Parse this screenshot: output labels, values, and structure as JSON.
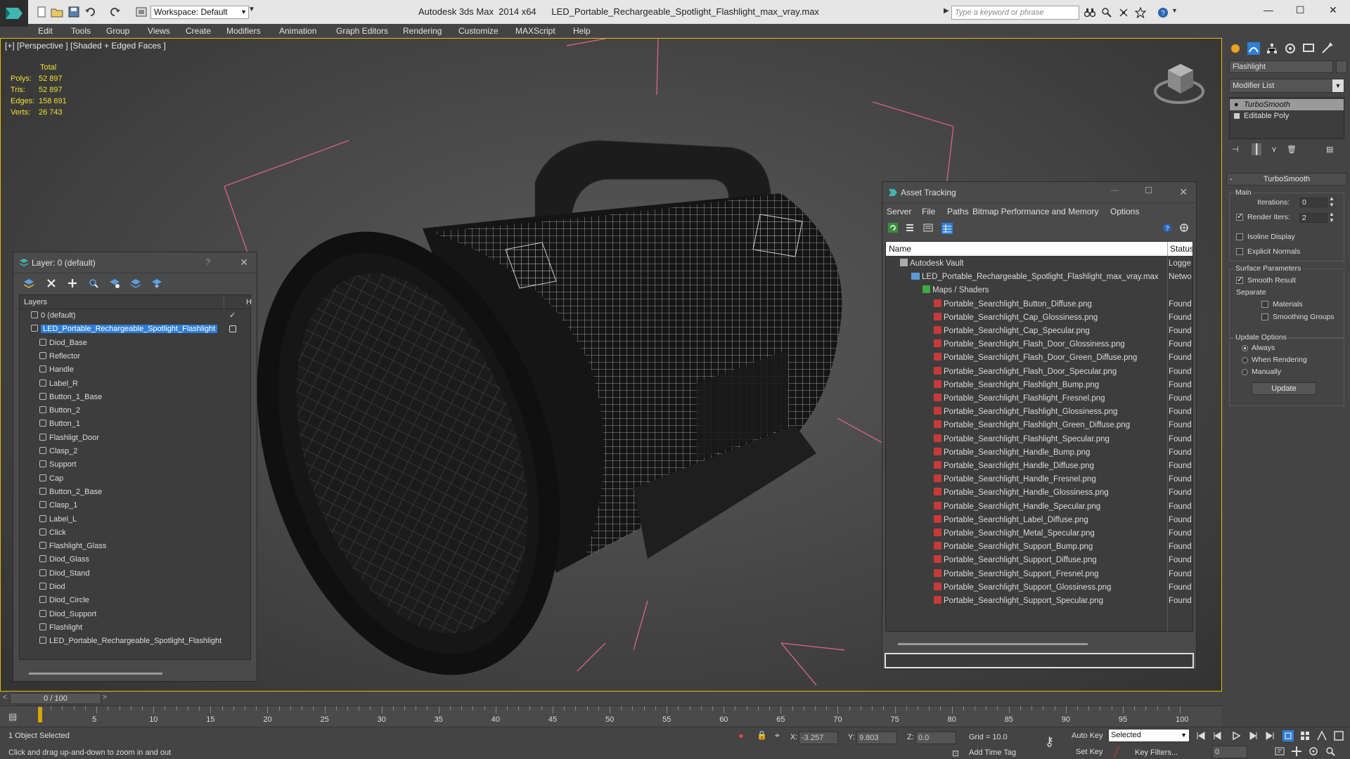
{
  "titlebar": {
    "workspace": "Workspace: Default",
    "title": "Autodesk 3ds Max  2014 x64      LED_Portable_Rechargeable_Spotlight_Flashlight_max_vray.max",
    "search_placeholder": "Type a keyword or phrase"
  },
  "menu": [
    "Edit",
    "Tools",
    "Group",
    "Views",
    "Create",
    "Modifiers",
    "Animation",
    "Graph Editors",
    "Rendering",
    "Customize",
    "MAXScript",
    "Help"
  ],
  "viewport": {
    "label": "[+] [Perspective ] [Shaded + Edged Faces ]",
    "stats_header": "Total",
    "stats": [
      {
        "k": "Polys:",
        "v": "52 897"
      },
      {
        "k": "Tris:",
        "v": "52 897"
      },
      {
        "k": "Edges:",
        "v": "158 691"
      },
      {
        "k": "Verts:",
        "v": "26 743"
      }
    ]
  },
  "layer_panel": {
    "title": "Layer: 0 (default)",
    "help": "?",
    "col_layers": "Layers",
    "col_h": "H",
    "rows": [
      {
        "label": "0 (default)",
        "indent": 0,
        "type": "layer",
        "check": true
      },
      {
        "label": "LED_Portable_Rechargeable_Spotlight_Flashlight",
        "indent": 0,
        "type": "layer",
        "selected": true
      },
      {
        "label": "Diod_Base",
        "indent": 1,
        "type": "obj"
      },
      {
        "label": "Reflector",
        "indent": 1,
        "type": "obj"
      },
      {
        "label": "Handle",
        "indent": 1,
        "type": "obj"
      },
      {
        "label": "Label_R",
        "indent": 1,
        "type": "obj"
      },
      {
        "label": "Button_1_Base",
        "indent": 1,
        "type": "obj"
      },
      {
        "label": "Button_2",
        "indent": 1,
        "type": "obj"
      },
      {
        "label": "Button_1",
        "indent": 1,
        "type": "obj"
      },
      {
        "label": "Flashligt_Door",
        "indent": 1,
        "type": "obj"
      },
      {
        "label": "Clasp_2",
        "indent": 1,
        "type": "obj"
      },
      {
        "label": "Support",
        "indent": 1,
        "type": "obj"
      },
      {
        "label": "Cap",
        "indent": 1,
        "type": "obj"
      },
      {
        "label": "Button_2_Base",
        "indent": 1,
        "type": "obj"
      },
      {
        "label": "Clasp_1",
        "indent": 1,
        "type": "obj"
      },
      {
        "label": "Label_L",
        "indent": 1,
        "type": "obj"
      },
      {
        "label": "Click",
        "indent": 1,
        "type": "obj"
      },
      {
        "label": "Flashlight_Glass",
        "indent": 1,
        "type": "obj"
      },
      {
        "label": "Diod_Glass",
        "indent": 1,
        "type": "obj"
      },
      {
        "label": "Diod_Stand",
        "indent": 1,
        "type": "obj"
      },
      {
        "label": "Diod",
        "indent": 1,
        "type": "obj"
      },
      {
        "label": "Diod_Circle",
        "indent": 1,
        "type": "obj"
      },
      {
        "label": "Diod_Support",
        "indent": 1,
        "type": "obj"
      },
      {
        "label": "Flashlight",
        "indent": 1,
        "type": "obj"
      },
      {
        "label": "LED_Portable_Rechargeable_Spotlight_Flashlight",
        "indent": 1,
        "type": "obj"
      }
    ]
  },
  "asset_panel": {
    "title": "Asset Tracking",
    "menu": [
      "Server",
      "File",
      "Paths",
      "Bitmap Performance and Memory",
      "Options"
    ],
    "col_name": "Name",
    "col_status": "Status",
    "rows": [
      {
        "label": "Autodesk Vault",
        "indent": 0,
        "icon": "vault",
        "status": "Logge"
      },
      {
        "label": "LED_Portable_Rechargeable_Spotlight_Flashlight_max_vray.max",
        "indent": 1,
        "icon": "file",
        "status": "Netwo"
      },
      {
        "label": "Maps / Shaders",
        "indent": 2,
        "icon": "map",
        "status": ""
      },
      {
        "label": "Portable_Searchlight_Button_Diffuse.png",
        "indent": 3,
        "icon": "png",
        "status": "Found"
      },
      {
        "label": "Portable_Searchlight_Cap_Glossiness.png",
        "indent": 3,
        "icon": "png",
        "status": "Found"
      },
      {
        "label": "Portable_Searchlight_Cap_Specular.png",
        "indent": 3,
        "icon": "png",
        "status": "Found"
      },
      {
        "label": "Portable_Searchlight_Flash_Door_Glossiness.png",
        "indent": 3,
        "icon": "png",
        "status": "Found"
      },
      {
        "label": "Portable_Searchlight_Flash_Door_Green_Diffuse.png",
        "indent": 3,
        "icon": "png",
        "status": "Found"
      },
      {
        "label": "Portable_Searchlight_Flash_Door_Specular.png",
        "indent": 3,
        "icon": "png",
        "status": "Found"
      },
      {
        "label": "Portable_Searchlight_Flashlight_Bump.png",
        "indent": 3,
        "icon": "png",
        "status": "Found"
      },
      {
        "label": "Portable_Searchlight_Flashlight_Fresnel.png",
        "indent": 3,
        "icon": "png",
        "status": "Found"
      },
      {
        "label": "Portable_Searchlight_Flashlight_Glossiness.png",
        "indent": 3,
        "icon": "png",
        "status": "Found"
      },
      {
        "label": "Portable_Searchlight_Flashlight_Green_Diffuse.png",
        "indent": 3,
        "icon": "png",
        "status": "Found"
      },
      {
        "label": "Portable_Searchlight_Flashlight_Specular.png",
        "indent": 3,
        "icon": "png",
        "status": "Found"
      },
      {
        "label": "Portable_Searchlight_Handle_Bump.png",
        "indent": 3,
        "icon": "png",
        "status": "Found"
      },
      {
        "label": "Portable_Searchlight_Handle_Diffuse.png",
        "indent": 3,
        "icon": "png",
        "status": "Found"
      },
      {
        "label": "Portable_Searchlight_Handle_Fresnel.png",
        "indent": 3,
        "icon": "png",
        "status": "Found"
      },
      {
        "label": "Portable_Searchlight_Handle_Glossiness.png",
        "indent": 3,
        "icon": "png",
        "status": "Found"
      },
      {
        "label": "Portable_Searchlight_Handle_Specular.png",
        "indent": 3,
        "icon": "png",
        "status": "Found"
      },
      {
        "label": "Portable_Searchlight_Label_Diffuse.png",
        "indent": 3,
        "icon": "png",
        "status": "Found"
      },
      {
        "label": "Portable_Searchlight_Metal_Specular.png",
        "indent": 3,
        "icon": "png",
        "status": "Found"
      },
      {
        "label": "Portable_Searchlight_Support_Bump.png",
        "indent": 3,
        "icon": "png",
        "status": "Found"
      },
      {
        "label": "Portable_Searchlight_Support_Diffuse.png",
        "indent": 3,
        "icon": "png",
        "status": "Found"
      },
      {
        "label": "Portable_Searchlight_Support_Fresnel.png",
        "indent": 3,
        "icon": "png",
        "status": "Found"
      },
      {
        "label": "Portable_Searchlight_Support_Glossiness.png",
        "indent": 3,
        "icon": "png",
        "status": "Found"
      },
      {
        "label": "Portable_Searchlight_Support_Specular.png",
        "indent": 3,
        "icon": "png",
        "status": "Found"
      }
    ]
  },
  "cmd_panel": {
    "object_name": "Flashlight",
    "modifier_list": "Modifier List",
    "stack": [
      "TurboSmooth",
      "Editable Poly"
    ],
    "rollout": "TurboSmooth",
    "main_group": "Main",
    "iterations_label": "Iterations:",
    "iterations_value": "0",
    "render_iters_label": "Render Iters:",
    "render_iters_value": "2",
    "isoline": "Isoline Display",
    "explicit_normals": "Explicit Normals",
    "surface_group": "Surface Parameters",
    "smooth_result": "Smooth Result",
    "separate": "Separate",
    "materials": "Materials",
    "smoothing_groups": "Smoothing Groups",
    "update_group": "Update Options",
    "always": "Always",
    "when_rendering": "When Rendering",
    "manually": "Manually",
    "update_btn": "Update"
  },
  "timeline": {
    "slider": "0 / 100",
    "ticks": [
      "5",
      "10",
      "15",
      "20",
      "25",
      "30",
      "35",
      "40",
      "45",
      "50",
      "55",
      "60",
      "65",
      "70",
      "75",
      "80",
      "85",
      "90",
      "95",
      "100"
    ]
  },
  "status": {
    "selected": "1 Object Selected",
    "prompt": "Click and drag up-and-down to zoom in and out",
    "x_label": "X:",
    "x_value": "-3.257",
    "y_label": "Y:",
    "y_value": "9.803",
    "z_label": "Z:",
    "z_value": "0.0",
    "grid": "Grid = 10.0",
    "add_time_tag": "Add Time Tag",
    "auto_key": "Auto Key",
    "set_key": "Set Key",
    "key_selected": "Selected",
    "key_filters": "Key Filters...",
    "frame": "0"
  },
  "colors": {
    "selection": "#2f7fd6",
    "viewport_border": "#e0c000",
    "stats": "#f0e030",
    "bbox": "#d0608a"
  }
}
